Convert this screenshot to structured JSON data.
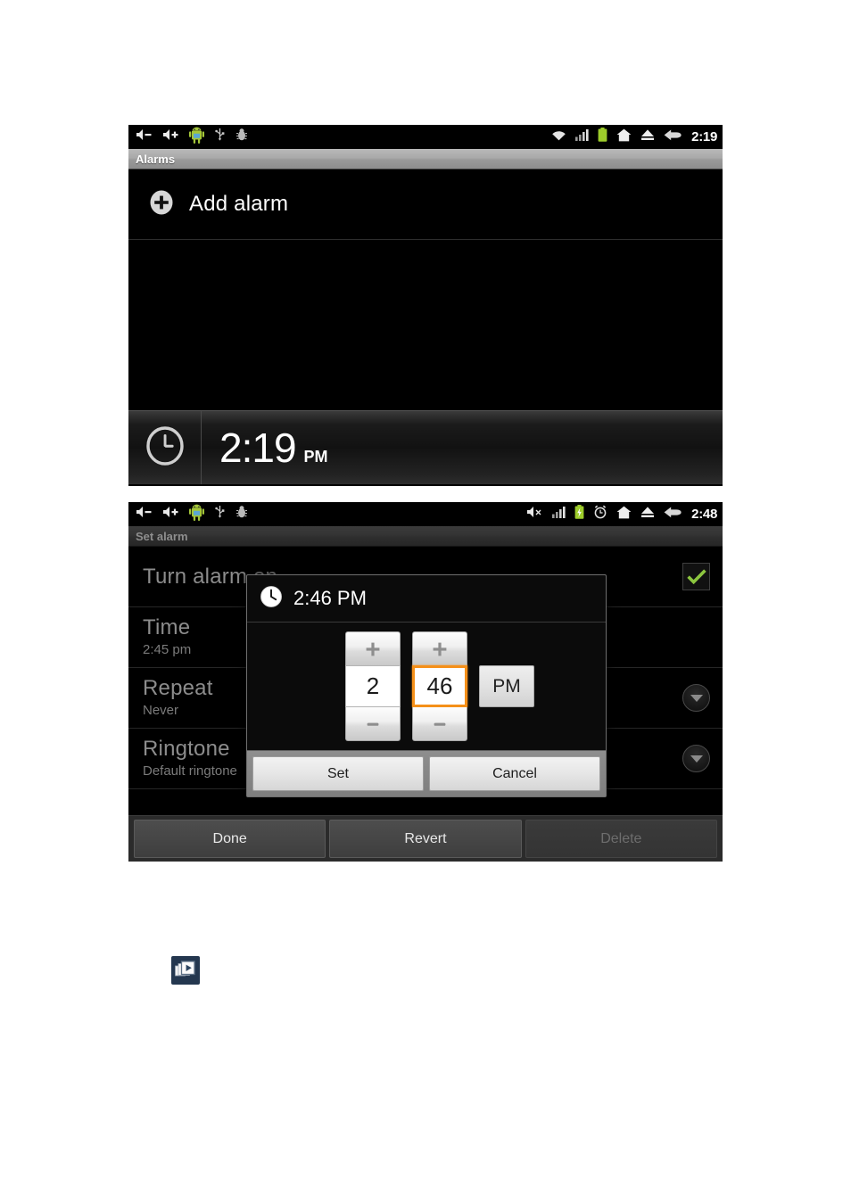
{
  "screens": [
    {
      "name": "alarms",
      "statusbar": {
        "left_icons": [
          "volume-down-icon",
          "volume-up-icon",
          "android-robot-icon",
          "usb-icon",
          "debug-bug-icon"
        ],
        "right_icons": [
          "wifi-icon",
          "signal-bars-icon",
          "battery-icon",
          "home-icon",
          "eject-icon",
          "back-icon"
        ],
        "clock": "2:19"
      },
      "title": "Alarms",
      "add_alarm": {
        "icon": "plus-circle-icon",
        "label": "Add alarm"
      },
      "footer_clock": {
        "icon": "clock-icon",
        "time": "2:19",
        "ampm": "PM"
      }
    },
    {
      "name": "set-alarm",
      "statusbar": {
        "left_icons": [
          "volume-down-icon",
          "volume-up-icon",
          "android-robot-icon",
          "usb-icon",
          "debug-bug-icon"
        ],
        "right_icons": [
          "volume-mute-icon",
          "signal-bars-icon",
          "battery-charging-icon",
          "alarm-clock-icon",
          "home-icon",
          "eject-icon",
          "back-icon"
        ],
        "clock": "2:48"
      },
      "title": "Set alarm",
      "rows": [
        {
          "title": "Turn alarm on",
          "sub": "",
          "accessory": "checkbox-checked"
        },
        {
          "title": "Time",
          "sub": "2:45 pm",
          "accessory": "none"
        },
        {
          "title": "Repeat",
          "sub": "Never",
          "accessory": "chevron-down"
        },
        {
          "title": "Ringtone",
          "sub": "Default ringtone",
          "accessory": "chevron-down"
        }
      ],
      "action_buttons": [
        {
          "label": "Done",
          "disabled": false
        },
        {
          "label": "Revert",
          "disabled": false
        },
        {
          "label": "Delete",
          "disabled": true
        }
      ],
      "dialog": {
        "icon": "clock-icon",
        "title": "2:46 PM",
        "hour": {
          "value": "2",
          "plus": "+",
          "minus": "–",
          "focused": false
        },
        "minute": {
          "value": "46",
          "plus": "+",
          "minus": "–",
          "focused": true
        },
        "ampm": "PM",
        "buttons": [
          {
            "label": "Set"
          },
          {
            "label": "Cancel"
          }
        ]
      }
    }
  ],
  "media_placeholder": {
    "icon": "image-placeholder-icon"
  },
  "colors": {
    "focus_orange": "#f59019",
    "check_green": "#8cc63f",
    "battery_green": "#9ecd2b",
    "screen_black": "#000000"
  }
}
